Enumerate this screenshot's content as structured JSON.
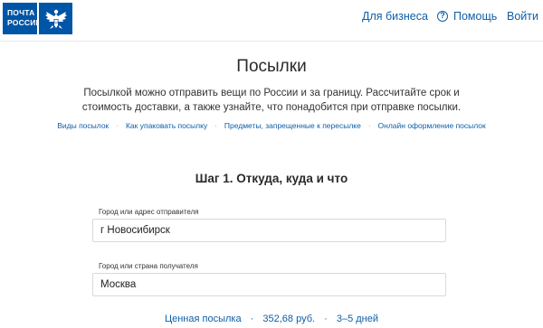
{
  "header": {
    "logo_line1": "ПОЧТА",
    "logo_line2": "РОССИИ",
    "nav_business": "Для бизнеса",
    "nav_help": "Помощь",
    "nav_login": "Войти"
  },
  "colors": {
    "brand": "#0055a6",
    "link": "#0f5fa8"
  },
  "page": {
    "title": "Посылки",
    "description_line1": "Посылкой можно отправить вещи по России и за границу. Рассчитайте срок и",
    "description_line2": "стоимость доставки, а также узнайте, что понадобится при отправке посылки."
  },
  "links": [
    "Виды посылок",
    "Как упаковать посылку",
    "Предметы, запрещенные к пересылке",
    "Онлайн оформление посылок"
  ],
  "link_separator": "·",
  "form": {
    "step_title": "Шаг 1. Откуда, куда и что",
    "sender_label": "Город или адрес отправителя",
    "sender_value": "г Новосибирск",
    "recipient_label": "Город или страна получателя",
    "recipient_value": "Москва"
  },
  "summary": {
    "type": "Ценная посылка",
    "price": "352,68 руб.",
    "term": "3–5 дней",
    "separator": "·"
  }
}
